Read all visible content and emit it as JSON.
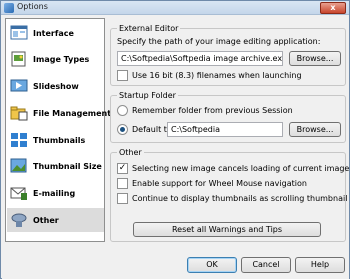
{
  "window": {
    "title": "Options",
    "close_glyph": "x"
  },
  "sidebar": {
    "items": [
      {
        "label": "Interface",
        "icon": "interface-icon",
        "selected": false
      },
      {
        "label": "Image Types",
        "icon": "image-types-icon",
        "selected": false
      },
      {
        "label": "Slideshow",
        "icon": "slideshow-icon",
        "selected": false
      },
      {
        "label": "File Management",
        "icon": "file-management-icon",
        "selected": false
      },
      {
        "label": "Thumbnails",
        "icon": "thumbnails-icon",
        "selected": false
      },
      {
        "label": "Thumbnail Size",
        "icon": "thumbnail-size-icon",
        "selected": false
      },
      {
        "label": "E-mailing",
        "icon": "email-icon",
        "selected": false
      },
      {
        "label": "Other",
        "icon": "other-icon",
        "selected": true
      }
    ]
  },
  "external_editor": {
    "title": "External Editor",
    "instruction": "Specify the path of your image editing application:",
    "path_value": "C:\\Softpedia\\Softpedia image archive.exe",
    "browse_label": "Browse...",
    "use16bit_label": "Use 16 bit (8.3) filenames when launching",
    "use16bit_checked": false
  },
  "startup_folder": {
    "title": "Startup Folder",
    "remember_label": "Remember folder from previous Session",
    "remember_selected": false,
    "default_label": "Default to:",
    "default_selected": true,
    "default_value": "C:\\Softpedia",
    "browse_label": "Browse..."
  },
  "other": {
    "title": "Other",
    "options": [
      {
        "label": "Selecting new image cancels loading of current image",
        "checked": true
      },
      {
        "label": "Enable support for Wheel Mouse navigation",
        "checked": false
      },
      {
        "label": "Continue to display thumbnails as scrolling thumbnail grid",
        "checked": false
      }
    ],
    "check_glyph": "✓",
    "reset_label": "Reset all Warnings and Tips"
  },
  "footer": {
    "ok_label": "OK",
    "cancel_label": "Cancel",
    "help_label": "Help"
  }
}
